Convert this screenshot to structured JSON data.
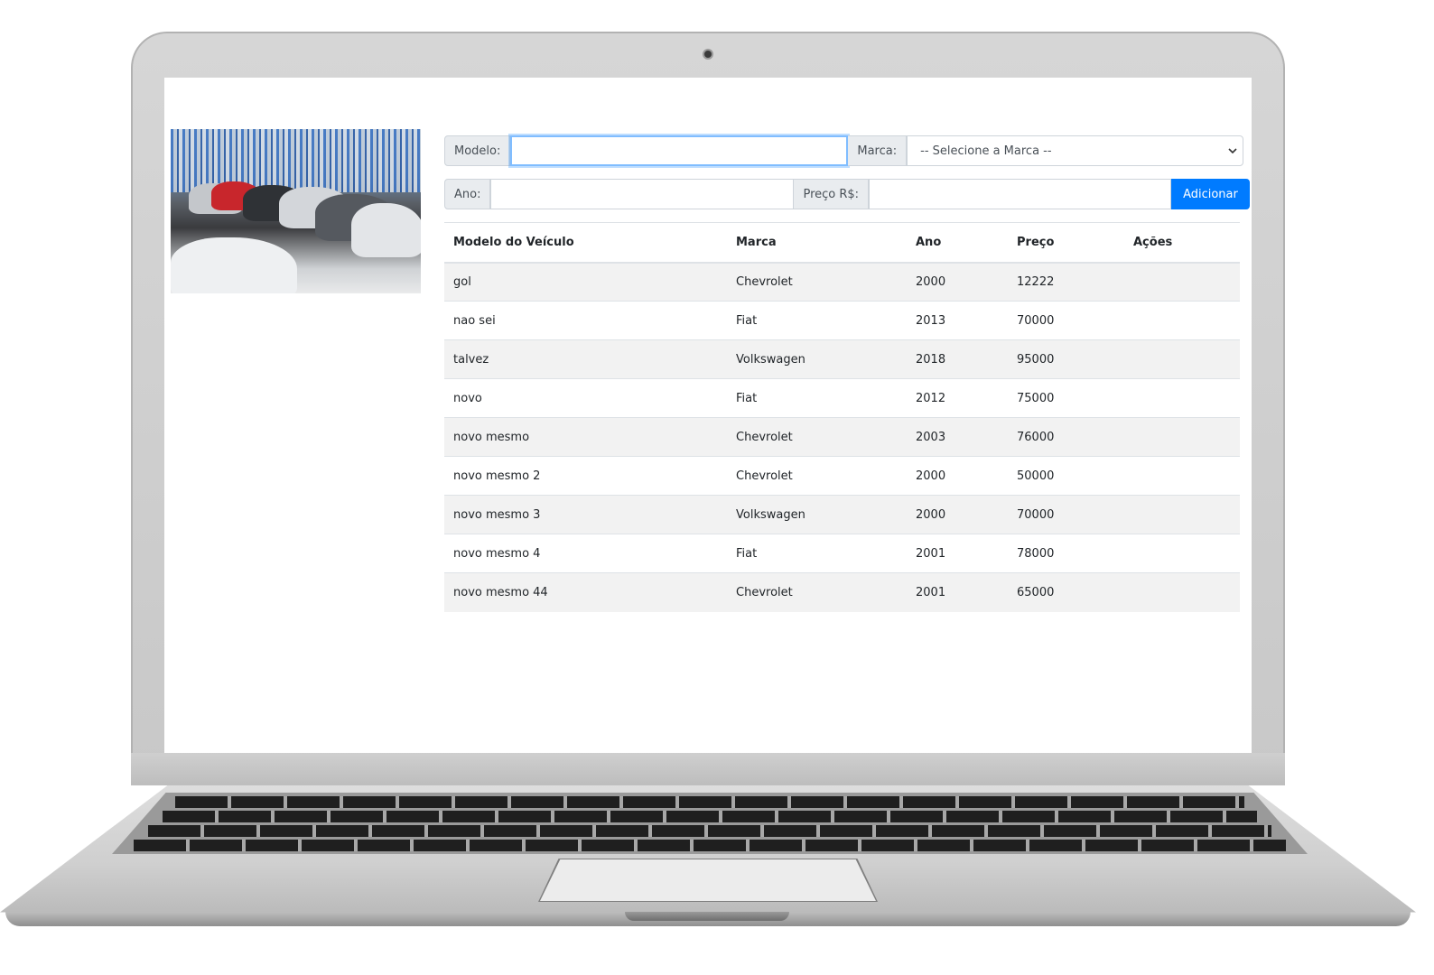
{
  "form": {
    "modelo_label": "Modelo:",
    "modelo_value": "",
    "marca_label": "Marca:",
    "marca_selected": "-- Selecione a Marca --",
    "ano_label": "Ano:",
    "ano_value": "",
    "preco_label": "Preço R$:",
    "preco_value": "",
    "add_button_label": "Adicionar"
  },
  "table": {
    "headers": [
      "Modelo do Veículo",
      "Marca",
      "Ano",
      "Preço",
      "Ações"
    ],
    "rows": [
      {
        "modelo": "gol",
        "marca": "Chevrolet",
        "ano": "2000",
        "preco": "12222"
      },
      {
        "modelo": "nao sei",
        "marca": "Fiat",
        "ano": "2013",
        "preco": "70000"
      },
      {
        "modelo": "talvez",
        "marca": "Volkswagen",
        "ano": "2018",
        "preco": "95000"
      },
      {
        "modelo": "novo",
        "marca": "Fiat",
        "ano": "2012",
        "preco": "75000"
      },
      {
        "modelo": "novo mesmo",
        "marca": "Chevrolet",
        "ano": "2003",
        "preco": "76000"
      },
      {
        "modelo": "novo mesmo 2",
        "marca": "Chevrolet",
        "ano": "2000",
        "preco": "50000"
      },
      {
        "modelo": "novo mesmo 3",
        "marca": "Volkswagen",
        "ano": "2000",
        "preco": "70000"
      },
      {
        "modelo": "novo mesmo 4",
        "marca": "Fiat",
        "ano": "2001",
        "preco": "78000"
      },
      {
        "modelo": "novo mesmo 44",
        "marca": "Chevrolet",
        "ano": "2001",
        "preco": "65000"
      }
    ]
  },
  "icons": {
    "select_caret": "chevron-down-icon"
  },
  "colors": {
    "primary": "#007bff",
    "addon_bg": "#e9ecef",
    "stripe": "#f2f2f2"
  }
}
